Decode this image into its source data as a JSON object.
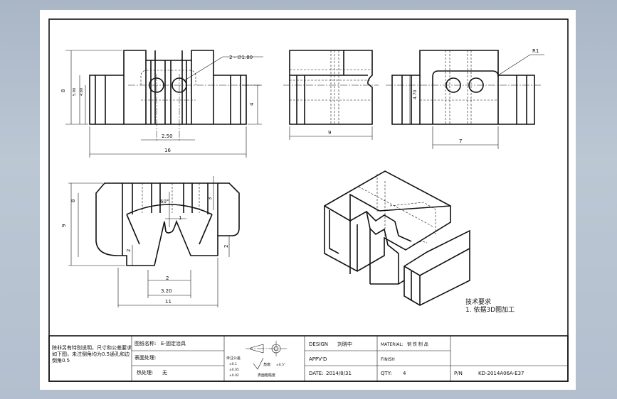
{
  "drawing": {
    "front_view": {
      "hole_callout": "2 - ∅1.80",
      "dim_height_overall": "8",
      "dim_height_a": "5.90",
      "dim_height_b": "4.80",
      "dim_height_right": "4",
      "dim_hole_pitch": "2.50",
      "dim_width": "16"
    },
    "side_view": {
      "dim_width": "9"
    },
    "rear_view": {
      "radius_callout": "R1",
      "dim_height": "4.70",
      "dim_width": "7"
    },
    "top_view": {
      "angle": "60°",
      "dim_slot_top": "1",
      "dim_height_overall": "9",
      "dim_height_inner": "8",
      "dim_step_right": "3",
      "dim_left_low": "2",
      "dim_right_low": "2",
      "dim_slot_bottom": "2",
      "dim_slot_width": "3.20",
      "dim_width": "11"
    },
    "tech_notes": {
      "title": "技术要求",
      "line1": "1. 依据3D图加工"
    }
  },
  "title_block": {
    "note": "除非另有特别说明，尺寸和公差要求如下图，未注倒角均为0.5通孔和边倒角0.5",
    "part_name_label": "图纸名称:",
    "part_name_value": "E-固定治具",
    "surface_label": "表面处理:",
    "heat_label": "热处理:",
    "heat_value": "无",
    "roughness_label": "表面粗糙度",
    "tol_title": "未注公差",
    "tol_rows": [
      "±0.1",
      "±0.05",
      "±0.02"
    ],
    "tol_angle_label": "角度:",
    "tol_angle_value": "±0.5°",
    "design_label": "DESIGN",
    "design_value": "刘晓中",
    "material_label": "MATERIAL:",
    "material_value": "钢 铁 制 品",
    "appvd_label": "APPV'D",
    "finish_label": "FINISH",
    "date_label": "DATE:",
    "date_value": "2014/8/31",
    "qty_label": "QTY:",
    "qty_value": "4",
    "pn_label": "P/N",
    "pn_value": "KD-2014A06A-E37"
  }
}
